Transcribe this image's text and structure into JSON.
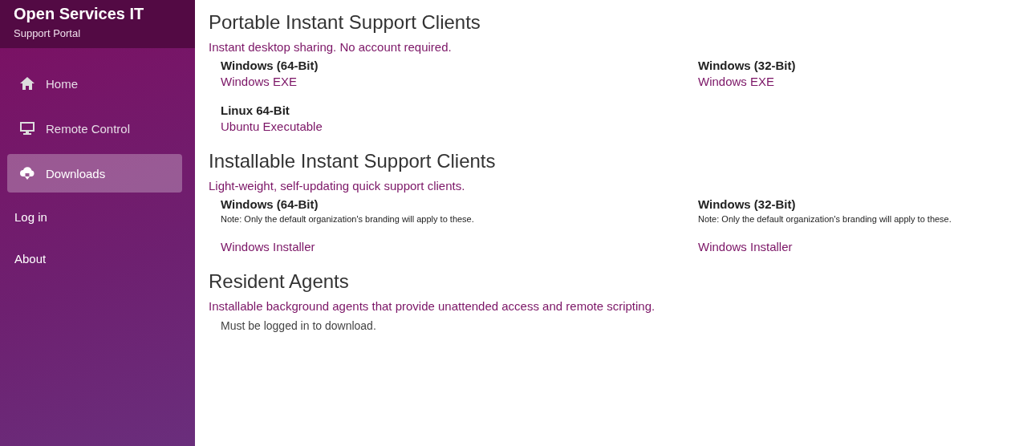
{
  "sidebar": {
    "brand": {
      "title": "Open Services IT",
      "subtitle": "Support Portal"
    },
    "items": [
      {
        "label": "Home",
        "kind": "home",
        "selected": false
      },
      {
        "label": "Remote Control",
        "kind": "monitor",
        "selected": false
      },
      {
        "label": "Downloads",
        "kind": "cloud",
        "selected": true
      },
      {
        "label": "Log in",
        "kind": "plain",
        "selected": false
      },
      {
        "label": "About",
        "kind": "plain",
        "selected": false
      }
    ]
  },
  "sections": [
    {
      "title": "Portable Instant Support Clients",
      "subtitle": "Instant desktop sharing. No account required.",
      "items": [
        {
          "name": "Windows (64-Bit)",
          "link": "Windows EXE"
        },
        {
          "name": "Windows (32-Bit)",
          "link": "Windows EXE"
        },
        {
          "name": "Linux 64-Bit",
          "link": "Ubuntu Executable"
        }
      ]
    },
    {
      "title": "Installable Instant Support Clients",
      "subtitle": "Light-weight, self-updating quick support clients.",
      "items": [
        {
          "name": "Windows (64-Bit)",
          "note": "Note: Only the default organization's branding will apply to these.",
          "link": "Windows Installer"
        },
        {
          "name": "Windows (32-Bit)",
          "note": "Note: Only the default organization's branding will apply to these.",
          "link": "Windows Installer"
        }
      ]
    },
    {
      "title": "Resident Agents",
      "subtitle": "Installable background agents that provide unattended access and remote scripting.",
      "message": "Must be logged in to download."
    }
  ]
}
